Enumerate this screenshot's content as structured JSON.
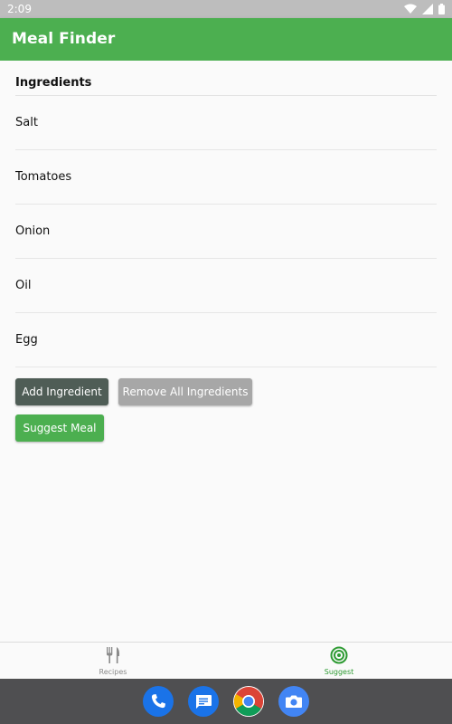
{
  "status_bar": {
    "time": "2:09"
  },
  "app_bar": {
    "title": "Meal Finder"
  },
  "ingredients": {
    "heading": "Ingredients",
    "items": [
      {
        "name": "Salt"
      },
      {
        "name": "Tomatoes"
      },
      {
        "name": "Onion"
      },
      {
        "name": "Oil"
      },
      {
        "name": "Egg"
      }
    ]
  },
  "actions": {
    "add_label": "Add Ingredient",
    "remove_all_label": "Remove All Ingredients",
    "suggest_label": "Suggest Meal"
  },
  "bottom_nav": {
    "items": [
      {
        "label": "Recipes",
        "icon": "fork-knife-icon",
        "active": false
      },
      {
        "label": "Suggest",
        "icon": "target-icon",
        "active": true
      }
    ]
  },
  "taskbar": {
    "apps": [
      {
        "icon": "phone-icon"
      },
      {
        "icon": "messages-icon"
      },
      {
        "icon": "chrome-icon"
      },
      {
        "icon": "camera-icon"
      }
    ]
  },
  "colors": {
    "primary": "#4caf50",
    "add_button": "#4f5d56",
    "remove_button": "#a7a7a7",
    "status_bar": "#bdbdbd",
    "taskbar": "#4f4f51"
  }
}
